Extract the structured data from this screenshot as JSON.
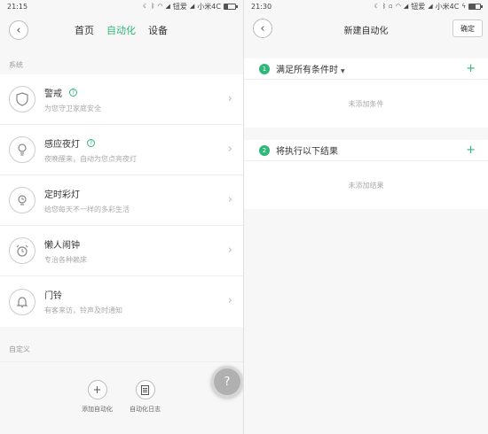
{
  "left": {
    "status": {
      "time": "21:15",
      "battery_level": 0.35
    },
    "header": {
      "tabs": [
        "首页",
        "自动化",
        "设备"
      ],
      "active_tab": 1
    },
    "section_system": "系统",
    "items": [
      {
        "title": "警戒",
        "subtitle": "为您守卫家庭安全",
        "icon": "shield-icon",
        "help": true
      },
      {
        "title": "感应夜灯",
        "subtitle": "夜晚醒来，自动为您点亮夜灯",
        "icon": "lightbulb-icon",
        "help": true
      },
      {
        "title": "定时彩灯",
        "subtitle": "给您每天不一样的多彩生活",
        "icon": "timer-lamp-icon",
        "help": false
      },
      {
        "title": "懒人闹钟",
        "subtitle": "专治各种赖床",
        "icon": "alarm-clock-icon",
        "help": false
      },
      {
        "title": "门铃",
        "subtitle": "有客来访，铃声及时通知",
        "icon": "bell-icon",
        "help": false
      }
    ],
    "section_custom": "自定义",
    "actions": {
      "add_label": "添加自动化",
      "log_label": "自动化日志"
    }
  },
  "right": {
    "status": {
      "time": "21:30",
      "carrier1": "钮爱",
      "carrier2": "小米4C",
      "battery_level": 0.6
    },
    "title": "新建自动化",
    "confirm_label": "确定",
    "conditions": {
      "index": "1",
      "title": "满足所有条件时",
      "empty": "未添加条件"
    },
    "results": {
      "index": "2",
      "title": "将执行以下结果",
      "empty": "未添加结果"
    }
  },
  "left_status_carriers": {
    "carrier1": "钮爱",
    "carrier2": "小米4C"
  }
}
